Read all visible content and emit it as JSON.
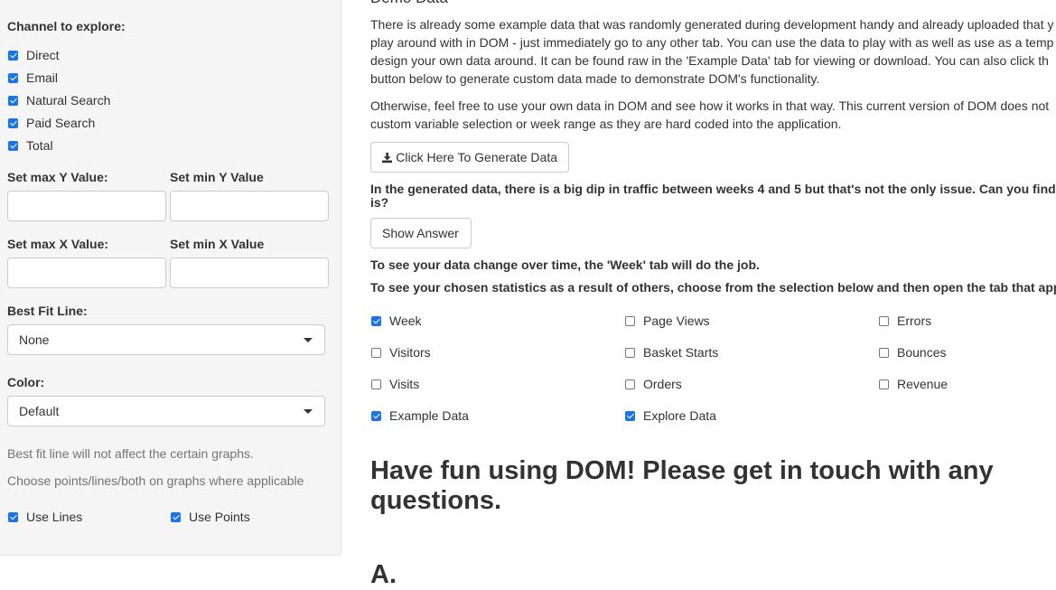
{
  "sidebar": {
    "channel_label": "Channel to explore:",
    "channels": [
      {
        "label": "Direct",
        "checked": true
      },
      {
        "label": "Email",
        "checked": true
      },
      {
        "label": "Natural Search",
        "checked": true
      },
      {
        "label": "Paid Search",
        "checked": true
      },
      {
        "label": "Total",
        "checked": true
      }
    ],
    "max_y_label": "Set max Y Value:",
    "min_y_label": "Set min Y Value",
    "max_x_label": "Set max X Value:",
    "min_x_label": "Set min X Value",
    "max_y_value": "",
    "min_y_value": "",
    "max_x_value": "",
    "min_x_value": "",
    "best_fit_label": "Best Fit Line:",
    "best_fit_value": "None",
    "color_label": "Color:",
    "color_value": "Default",
    "help1": "Best fit line will not affect the certain graphs.",
    "help2": "Choose points/lines/both on graphs where applicable",
    "use_lines": {
      "label": "Use Lines",
      "checked": true
    },
    "use_points": {
      "label": "Use Points",
      "checked": true
    }
  },
  "main": {
    "section_title": "Demo Data",
    "para1_lines": [
      "There is already some example data that was randomly generated during development handy and already uploaded that y",
      "play around with in DOM - just immediately go to any other tab. You can use the data to play with as well as use as a temp",
      "design your own data around. It can be found raw in the 'Example Data' tab for viewing or download. You can also click th",
      "button below to generate custom data made to demonstrate DOM's functionality."
    ],
    "para2_lines": [
      "Otherwise, feel free to use your own data in DOM and see how it works in that way. This current version of DOM does not",
      "custom variable selection or week range as they are hard coded into the application."
    ],
    "generate_button": "Click Here To Generate Data",
    "question_lines": [
      "In the generated data, there is a big dip in traffic between weeks 4 and 5 but that's not the only issue. Can you find ou",
      "is?"
    ],
    "show_answer_button": "Show Answer",
    "week_line": "To see your data change over time, the 'Week' tab will do the job.",
    "stats_line": "To see your chosen statistics as a result of others, choose from the selection below and then open the tab that appear",
    "options": [
      {
        "label": "Week",
        "checked": true
      },
      {
        "label": "Page Views",
        "checked": false
      },
      {
        "label": "Errors",
        "checked": false
      },
      {
        "label": "Visitors",
        "checked": false
      },
      {
        "label": "Basket Starts",
        "checked": false
      },
      {
        "label": "Bounces",
        "checked": false
      },
      {
        "label": "Visits",
        "checked": false
      },
      {
        "label": "Orders",
        "checked": false
      },
      {
        "label": "Revenue",
        "checked": false
      },
      {
        "label": "Example Data",
        "checked": true
      },
      {
        "label": "Explore Data",
        "checked": true
      }
    ],
    "fun_heading_lines": [
      "Have fun using DOM! Please get in touch with any",
      "questions."
    ],
    "a_heading": "A.",
    "accent_color": "#1a73e8"
  }
}
